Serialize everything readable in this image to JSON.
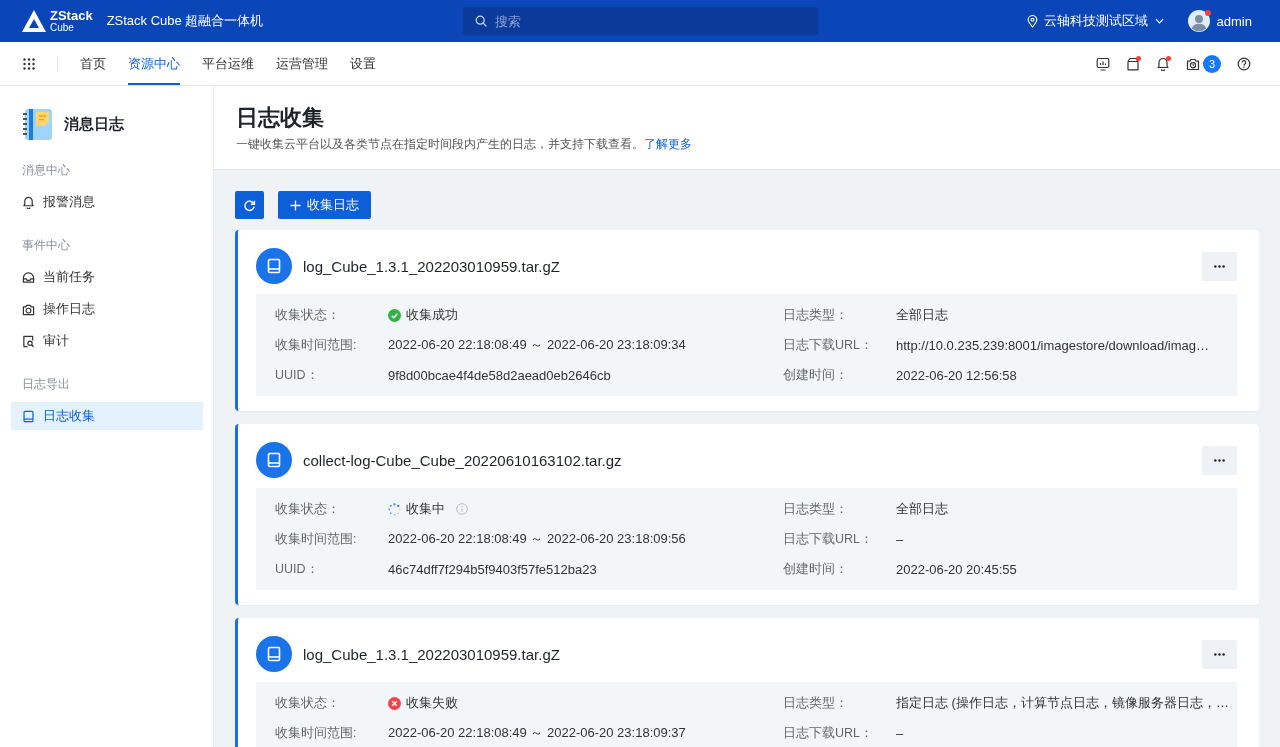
{
  "topbar": {
    "logo": {
      "text": "ZStack",
      "subtext": "Cube"
    },
    "title": "ZStack Cube 超融合一体机",
    "search": {
      "placeholder": "搜索"
    },
    "region": "云轴科技测试区域",
    "user": {
      "name": "admin",
      "notification": true
    }
  },
  "nav": {
    "tabs": [
      {
        "label": "首页",
        "selected": false
      },
      {
        "label": "资源中心",
        "selected": true
      },
      {
        "label": "平台运维",
        "selected": false
      },
      {
        "label": "运营管理",
        "selected": false
      },
      {
        "label": "设置",
        "selected": false
      }
    ],
    "tools": [
      {
        "kind": "monitor",
        "dot": false
      },
      {
        "kind": "box",
        "dot": true
      },
      {
        "kind": "bell",
        "dot": true
      },
      {
        "kind": "camera",
        "dot": false,
        "badge": "3"
      },
      {
        "kind": "help",
        "dot": false
      }
    ]
  },
  "sidebar": {
    "title": "消息日志",
    "groups": [
      {
        "heading": "消息中心",
        "items": [
          {
            "kind": "bell",
            "label": "报警消息",
            "selected": false
          }
        ]
      },
      {
        "heading": "事件中心",
        "items": [
          {
            "kind": "tray",
            "label": "当前任务",
            "selected": false
          },
          {
            "kind": "camera",
            "label": "操作日志",
            "selected": false
          },
          {
            "kind": "audit",
            "label": "审计",
            "selected": false
          }
        ]
      },
      {
        "heading": "日志导出",
        "items": [
          {
            "kind": "book",
            "label": "日志收集",
            "selected": true
          }
        ]
      }
    ]
  },
  "page": {
    "title": "日志收集",
    "description": "一键收集云平台以及各类节点在指定时间段内产生的日志，并支持下载查看。",
    "link": "了解更多"
  },
  "actions": [
    {
      "kind": "refresh"
    },
    {
      "kind": "add",
      "label": "收集日志"
    }
  ],
  "logs": [
    {
      "name": "log_Cube_1.3.1_202203010959.tar.gZ",
      "fields": [
        {
          "kind": "success",
          "label": "收集状态：",
          "value": "收集成功",
          "info": false
        },
        {
          "kind": "text",
          "label": "日志类型：",
          "value": "全部日志"
        },
        {
          "kind": "text",
          "label": "收集时间范围:",
          "value": "2022-06-20 22:18:08:49 ～ 2022-06-20 23:18:09:34"
        },
        {
          "kind": "text",
          "label": "日志下载URL：",
          "value": "http://10.0.235.239:8001/imagestore/download/imag…"
        },
        {
          "kind": "text",
          "label": "UUID：",
          "value": "9f8d00bcae4f4de58d2aead0eb2646cb"
        },
        {
          "kind": "text",
          "label": "创建时间：",
          "value": "2022-06-20 12:56:58"
        }
      ]
    },
    {
      "name": "collect-log-Cube_Cube_20220610163102.tar.gz",
      "fields": [
        {
          "kind": "running",
          "label": "收集状态：",
          "value": "收集中",
          "info": true
        },
        {
          "kind": "text",
          "label": "日志类型：",
          "value": "全部日志"
        },
        {
          "kind": "text",
          "label": "收集时间范围:",
          "value": "2022-06-20 22:18:08:49 ～ 2022-06-20 23:18:09:56"
        },
        {
          "kind": "text",
          "label": "日志下载URL：",
          "value": "–"
        },
        {
          "kind": "text",
          "label": "UUID：",
          "value": "46c74dff7f294b5f9403f57fe512ba23"
        },
        {
          "kind": "text",
          "label": "创建时间：",
          "value": "2022-06-20 20:45:55"
        }
      ]
    },
    {
      "name": "log_Cube_1.3.1_202203010959.tar.gZ",
      "fields": [
        {
          "kind": "failed",
          "label": "收集状态：",
          "value": "收集失败",
          "info": false
        },
        {
          "kind": "text",
          "label": "日志类型：",
          "value": "指定日志 (操作日志，计算节点日志，镜像服务器日志，…"
        },
        {
          "kind": "text",
          "label": "收集时间范围:",
          "value": "2022-06-20 22:18:08:49 ～ 2022-06-20 23:18:09:37"
        },
        {
          "kind": "text",
          "label": "日志下载URL：",
          "value": "–"
        }
      ]
    }
  ]
}
